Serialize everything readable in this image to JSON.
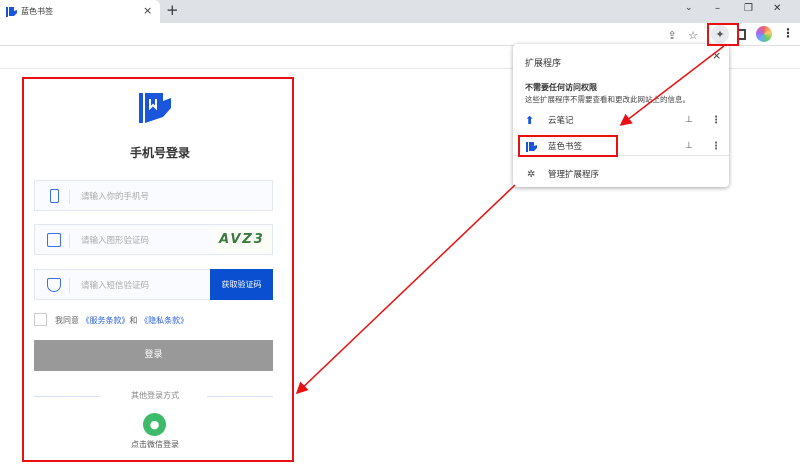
{
  "browser": {
    "tab_title": "蓝色书签",
    "new_tab": "+",
    "close_tab": "×"
  },
  "extensions_popup": {
    "title": "扩展程序",
    "close": "×",
    "section_heading": "不需要任何访问权限",
    "section_desc": "这些扩展程序不需要查看和更改此网站上的信息。",
    "items": [
      {
        "label": "云笔记"
      },
      {
        "label": "蓝色书签"
      }
    ],
    "manage": "管理扩展程序"
  },
  "login": {
    "title": "手机号登录",
    "phone_placeholder": "请输入你的手机号",
    "captcha_placeholder": "请输入图形验证码",
    "captcha_text": "AVZ3",
    "sms_placeholder": "请输入短信验证码",
    "get_code": "获取验证码",
    "agree_prefix": "我同意",
    "terms": "《服务条款》",
    "and": "和",
    "privacy": "《隐私条款》",
    "submit": "登录",
    "other_methods": "其他登录方式",
    "wechat": "点击微信登录"
  },
  "colors": {
    "brand": "#1a56db",
    "annotation": "#e81010",
    "wechat": "#3dbb6a"
  }
}
